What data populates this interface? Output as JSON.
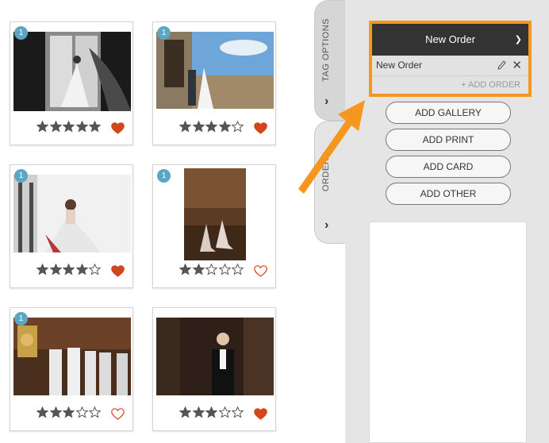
{
  "tabs": {
    "tag_options": "TAG OPTIONS",
    "orders": "ORDERS"
  },
  "order": {
    "selected": "New Order",
    "name": "New Order",
    "add_order": "+ ADD ORDER"
  },
  "buttons": {
    "add_gallery": "ADD GALLERY",
    "add_print": "ADD PRINT",
    "add_card": "ADD CARD",
    "add_other": "ADD OTHER"
  },
  "photos": [
    {
      "badge": "1",
      "rating": 5,
      "favorite": true
    },
    {
      "badge": "1",
      "rating": 4,
      "favorite": true
    },
    {
      "badge": "1",
      "rating": 4,
      "favorite": true
    },
    {
      "badge": "1",
      "rating": 2,
      "favorite": false
    },
    {
      "badge": "1",
      "rating": 3,
      "favorite": false
    },
    {
      "badge": "",
      "rating": 3,
      "favorite": true
    }
  ],
  "colors": {
    "accent": "#f5971e",
    "badge": "#5aa7c4",
    "heart": "#d2461e",
    "star": "#555555"
  }
}
